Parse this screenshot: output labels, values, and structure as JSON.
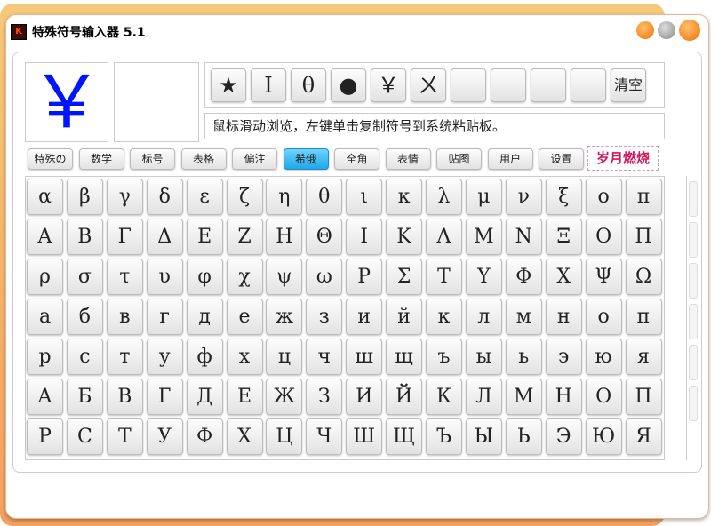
{
  "window": {
    "title": "特殊符号输入器 5.1",
    "app_icon": "K"
  },
  "preview": {
    "symbol": "￥"
  },
  "recent": {
    "symbols": [
      "★",
      "Ⅰ",
      "θ",
      "●",
      "￥",
      "ㄨ",
      "",
      "",
      "",
      ""
    ],
    "clear_label": "清空"
  },
  "hint": "鼠标滑动浏览，左键单击复制符号到系统粘贴板。",
  "tabs": [
    {
      "label": "特殊の"
    },
    {
      "label": "数学"
    },
    {
      "label": "标号"
    },
    {
      "label": "表格"
    },
    {
      "label": "偏注"
    },
    {
      "label": "希俄"
    },
    {
      "label": "全角"
    },
    {
      "label": "表情"
    },
    {
      "label": "贴图"
    },
    {
      "label": "用户"
    },
    {
      "label": "设置"
    }
  ],
  "active_tab": 5,
  "logo": "岁月燃烧",
  "grid": [
    [
      "α",
      "β",
      "γ",
      "δ",
      "ε",
      "ζ",
      "η",
      "θ",
      "ι",
      "κ",
      "λ",
      "μ",
      "ν",
      "ξ",
      "ο",
      "π"
    ],
    [
      "Α",
      "Β",
      "Γ",
      "Δ",
      "Ε",
      "Ζ",
      "Η",
      "Θ",
      "Ι",
      "Κ",
      "Λ",
      "Μ",
      "Ν",
      "Ξ",
      "Ο",
      "Π"
    ],
    [
      "ρ",
      "σ",
      "τ",
      "υ",
      "φ",
      "χ",
      "ψ",
      "ω",
      "Ρ",
      "Σ",
      "Τ",
      "Υ",
      "Φ",
      "Χ",
      "Ψ",
      "Ω"
    ],
    [
      "а",
      "б",
      "в",
      "г",
      "д",
      "е",
      "ж",
      "з",
      "и",
      "й",
      "к",
      "л",
      "м",
      "н",
      "о",
      "п"
    ],
    [
      "р",
      "с",
      "т",
      "у",
      "ф",
      "х",
      "ц",
      "ч",
      "ш",
      "щ",
      "ъ",
      "ы",
      "ь",
      "э",
      "ю",
      "я"
    ],
    [
      "А",
      "Б",
      "В",
      "Г",
      "Д",
      "Е",
      "Ж",
      "З",
      "И",
      "Й",
      "К",
      "Л",
      "М",
      "Н",
      "О",
      "П"
    ],
    [
      "Р",
      "С",
      "Т",
      "У",
      "Ф",
      "Х",
      "Ц",
      "Ч",
      "Ш",
      "Щ",
      "Ъ",
      "Ы",
      "Ь",
      "Э",
      "Ю",
      "Я"
    ]
  ],
  "colors": {
    "accent": "#22a8e8",
    "frame": "#f3a060",
    "preview": "#0015ff",
    "logo": "#d4145a"
  }
}
